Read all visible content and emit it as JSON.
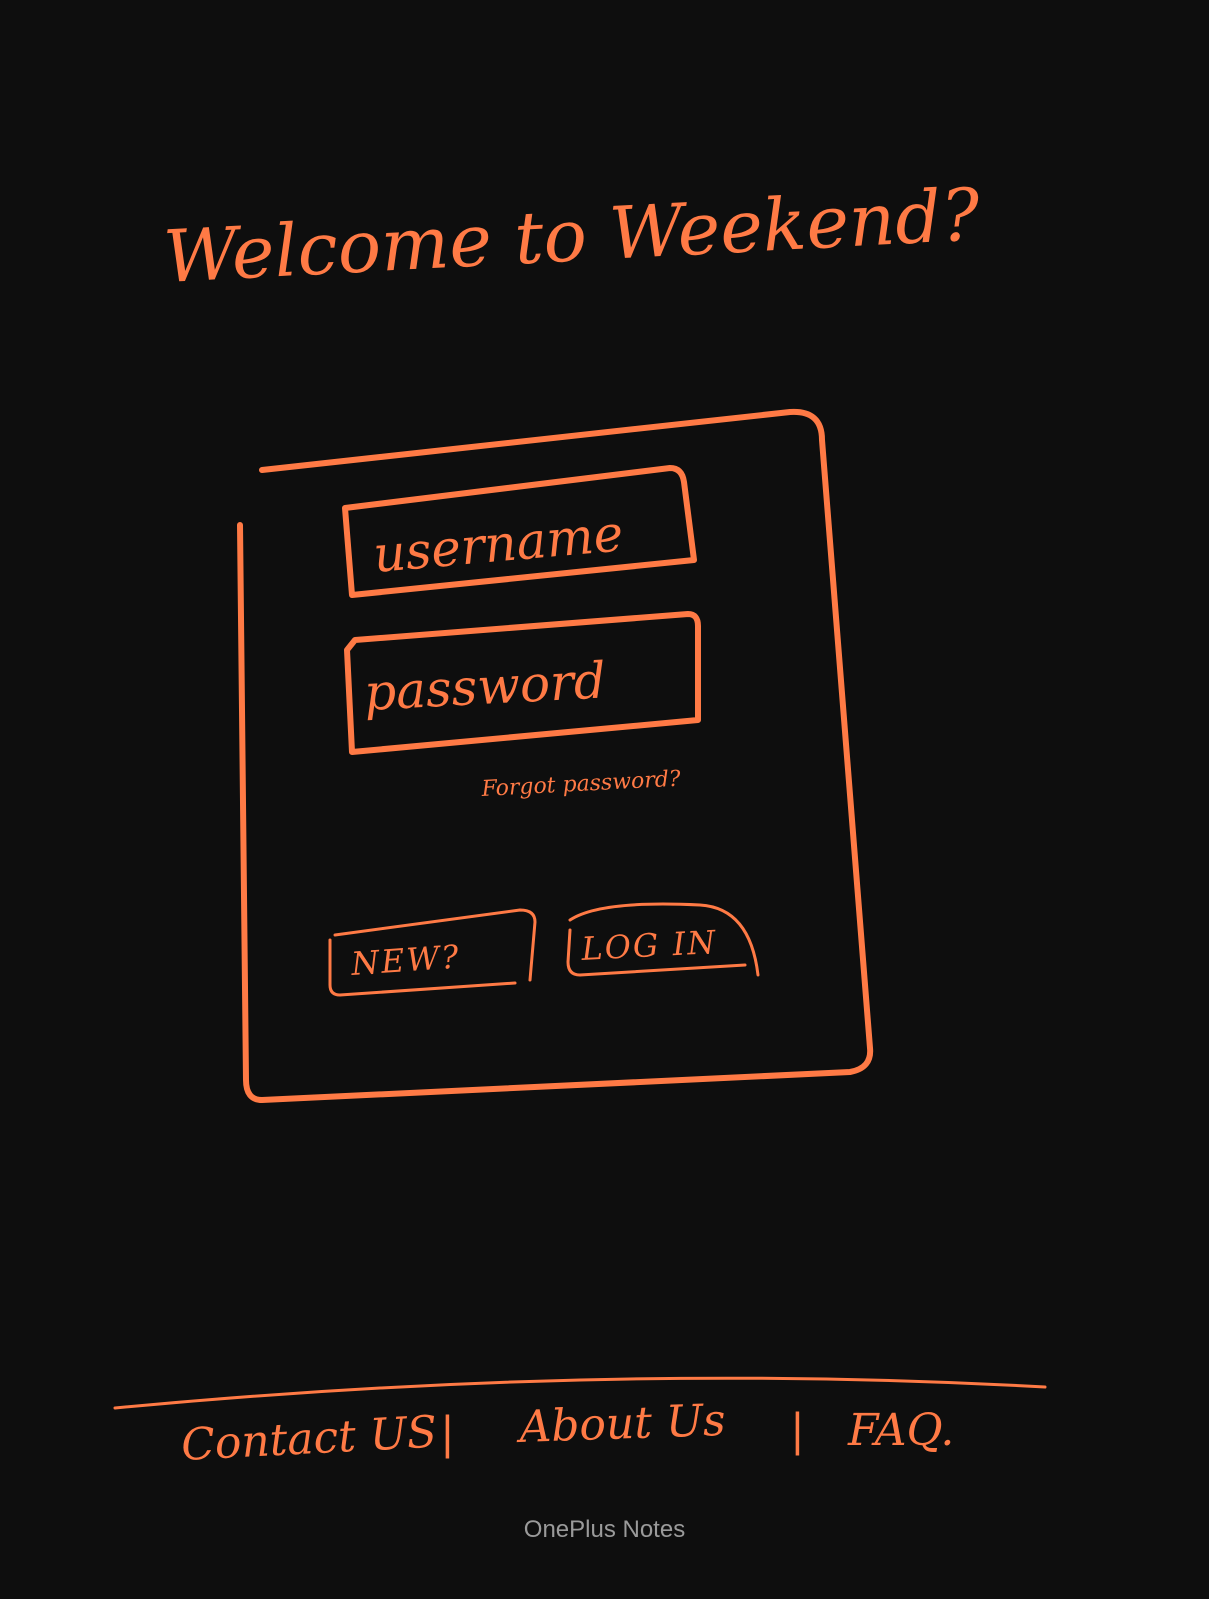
{
  "sketch": {
    "title": "Welcome to Weekend?",
    "login_form": {
      "username_field": "username",
      "password_field": "password",
      "forgot_password_link": "Forgot password?",
      "new_button": "NEW?",
      "login_button": "LOG IN"
    },
    "footer": {
      "contact_link": "Contact US",
      "sep_1": "|",
      "about_link": "About Us",
      "sep_2": "|",
      "faq_link": "FAQ."
    }
  },
  "app": {
    "watermark": "OnePlus Notes"
  },
  "colors": {
    "background": "#0e0e0e",
    "ink": "#ff7a45",
    "watermark": "#9a9a9a"
  }
}
